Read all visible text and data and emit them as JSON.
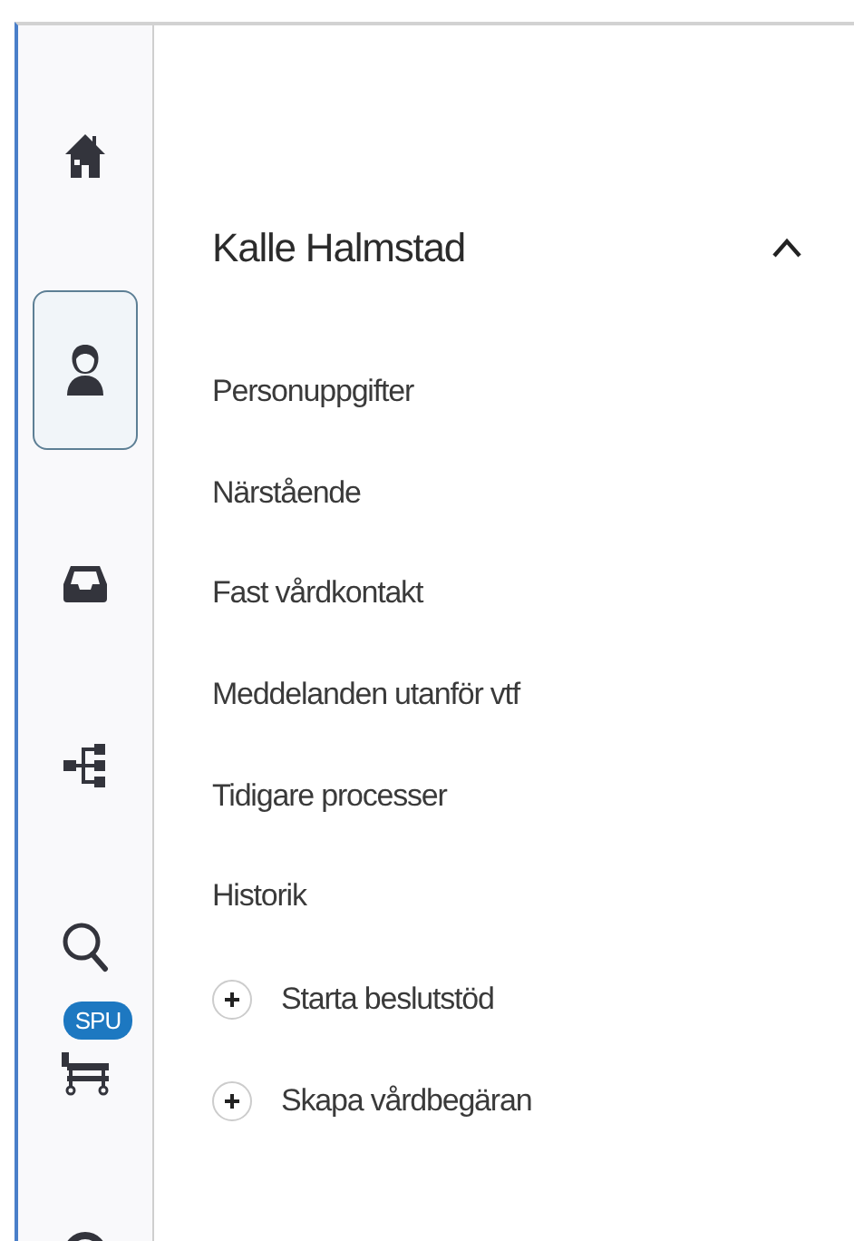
{
  "sidebar": {
    "items": [
      {
        "kind": "home",
        "selected": false
      },
      {
        "kind": "person",
        "selected": true
      },
      {
        "kind": "inbox",
        "selected": false
      },
      {
        "kind": "network",
        "selected": false
      },
      {
        "kind": "search",
        "selected": false
      },
      {
        "kind": "bed",
        "selected": false,
        "badge": "SPU"
      },
      {
        "kind": "circle",
        "selected": false
      }
    ]
  },
  "panel": {
    "title": "Kalle Halmstad",
    "expanded": true,
    "items": [
      {
        "kind": "link",
        "label": "Personuppgifter"
      },
      {
        "kind": "link",
        "label": "Närstående"
      },
      {
        "kind": "link",
        "label": "Fast vårdkontakt"
      },
      {
        "kind": "link",
        "label": "Meddelanden utanför vtf"
      },
      {
        "kind": "link",
        "label": "Tidigare processer"
      },
      {
        "kind": "link",
        "label": "Historik"
      },
      {
        "kind": "action",
        "label": "Starta beslutstöd"
      },
      {
        "kind": "action",
        "label": "Skapa vårdbegäran"
      }
    ]
  }
}
